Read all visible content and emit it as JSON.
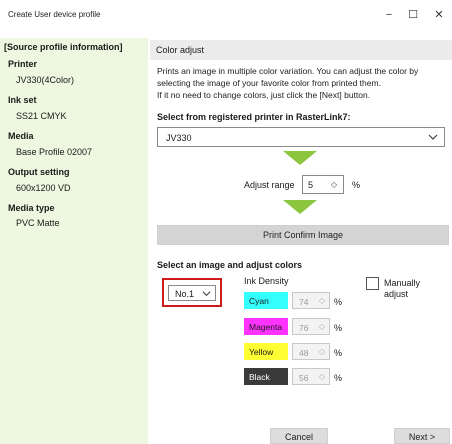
{
  "window": {
    "title": "Create User device profile",
    "minimize_glyph": "−",
    "maximize_glyph": "☐",
    "close_glyph": "✕"
  },
  "sidebar": {
    "header": "[Source profile information]",
    "sections": [
      {
        "label": "Printer",
        "value": "JV330(4Color)"
      },
      {
        "label": "Ink set",
        "value": "SS21 CMYK"
      },
      {
        "label": "Media",
        "value": "Base Profile 02007"
      },
      {
        "label": "Output setting",
        "value": "600x1200 VD"
      },
      {
        "label": "Media type",
        "value": "PVC Matte"
      }
    ]
  },
  "main": {
    "section_title": "Color adjust",
    "description": [
      "Prints an  image in multiple color variation. You can adjust the color by",
      "selecting the image of your favorite color from printed them.",
      "If it no need to change colors, just click the [Next] button."
    ],
    "printer_select_label": "Select from registered printer in RasterLink7:",
    "printer_select_value": "JV330",
    "adjust_range_label": "Adjust range",
    "adjust_range_value": "5",
    "adjust_range_unit": "%",
    "print_button": "Print Confirm Image",
    "select_image_label": "Select an image and adjust colors",
    "image_select_value": "No.1",
    "ink_density_label": "Ink Density",
    "inks": [
      {
        "name": "Cyan",
        "value": "74",
        "unit": "%",
        "color": "#33ffff"
      },
      {
        "name": "Magenta",
        "value": "76",
        "unit": "%",
        "color": "#ff33ff"
      },
      {
        "name": "Yellow",
        "value": "48",
        "unit": "%",
        "color": "#ffff33"
      },
      {
        "name": "Black",
        "value": "56",
        "unit": "%",
        "color": "#3a3a3a"
      }
    ],
    "manual_adjust_label_1": "Manually",
    "manual_adjust_label_2": "adjust",
    "spin_glyph": "◇"
  },
  "footer": {
    "cancel_label": "Cancel",
    "next_label": "Next >"
  },
  "colors": {
    "sidebar_bg": "#eef7df",
    "arrow": "#8cc63f",
    "highlight_border": "#d0191b"
  }
}
